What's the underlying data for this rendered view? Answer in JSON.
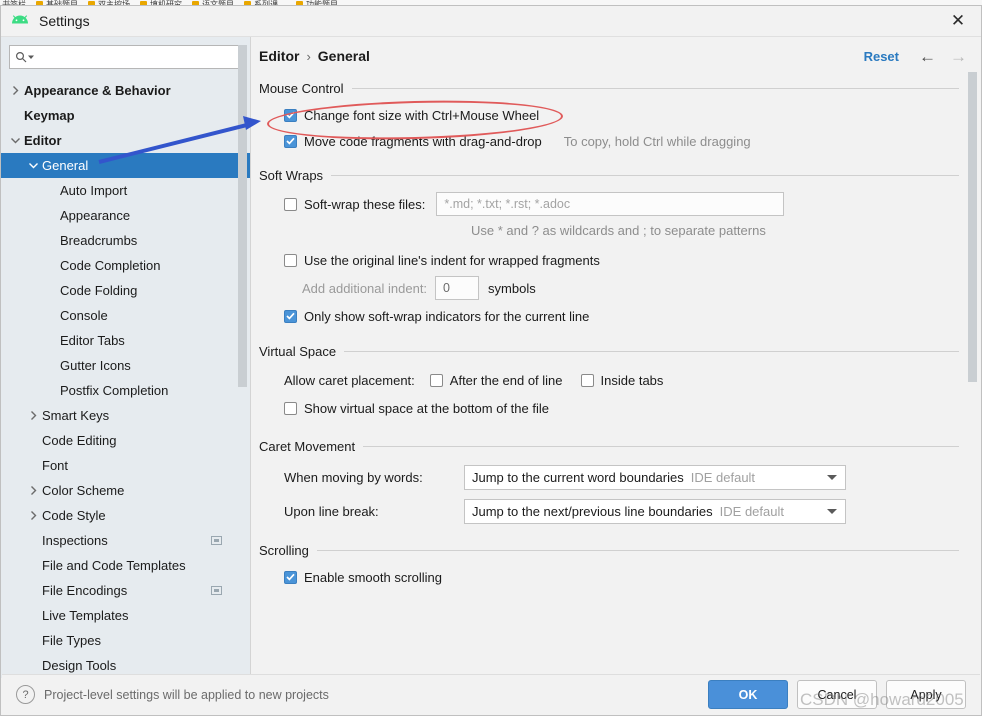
{
  "bookmarks": [
    {
      "label": "书签栏"
    },
    {
      "label": "基础题目"
    },
    {
      "label": "双主控场"
    },
    {
      "label": "填机研究"
    },
    {
      "label": "语文题目"
    },
    {
      "label": "系列课、"
    },
    {
      "label": "功能题目"
    }
  ],
  "window": {
    "title": "Settings",
    "icon": "android-icon",
    "close_label": "✕"
  },
  "sidebar": {
    "search": {
      "value": "",
      "placeholder": "",
      "icon": "search-icon"
    },
    "items": [
      {
        "label": "Appearance & Behavior",
        "indent": 0,
        "chevron": "right",
        "bold": true,
        "selected": false,
        "project_icon": false
      },
      {
        "label": "Keymap",
        "indent": 0,
        "chevron": "none",
        "bold": true,
        "selected": false,
        "project_icon": false
      },
      {
        "label": "Editor",
        "indent": 0,
        "chevron": "down",
        "bold": true,
        "selected": false,
        "project_icon": false
      },
      {
        "label": "General",
        "indent": 1,
        "chevron": "down",
        "bold": false,
        "selected": true,
        "project_icon": false
      },
      {
        "label": "Auto Import",
        "indent": 2,
        "chevron": "none",
        "bold": false,
        "selected": false,
        "project_icon": false
      },
      {
        "label": "Appearance",
        "indent": 2,
        "chevron": "none",
        "bold": false,
        "selected": false,
        "project_icon": false
      },
      {
        "label": "Breadcrumbs",
        "indent": 2,
        "chevron": "none",
        "bold": false,
        "selected": false,
        "project_icon": false
      },
      {
        "label": "Code Completion",
        "indent": 2,
        "chevron": "none",
        "bold": false,
        "selected": false,
        "project_icon": false
      },
      {
        "label": "Code Folding",
        "indent": 2,
        "chevron": "none",
        "bold": false,
        "selected": false,
        "project_icon": false
      },
      {
        "label": "Console",
        "indent": 2,
        "chevron": "none",
        "bold": false,
        "selected": false,
        "project_icon": false
      },
      {
        "label": "Editor Tabs",
        "indent": 2,
        "chevron": "none",
        "bold": false,
        "selected": false,
        "project_icon": false
      },
      {
        "label": "Gutter Icons",
        "indent": 2,
        "chevron": "none",
        "bold": false,
        "selected": false,
        "project_icon": false
      },
      {
        "label": "Postfix Completion",
        "indent": 2,
        "chevron": "none",
        "bold": false,
        "selected": false,
        "project_icon": false
      },
      {
        "label": "Smart Keys",
        "indent": 1,
        "chevron": "right",
        "bold": false,
        "selected": false,
        "project_icon": false
      },
      {
        "label": "Code Editing",
        "indent": 1,
        "chevron": "none",
        "bold": false,
        "selected": false,
        "project_icon": false
      },
      {
        "label": "Font",
        "indent": 1,
        "chevron": "none",
        "bold": false,
        "selected": false,
        "project_icon": false
      },
      {
        "label": "Color Scheme",
        "indent": 1,
        "chevron": "right",
        "bold": false,
        "selected": false,
        "project_icon": false
      },
      {
        "label": "Code Style",
        "indent": 1,
        "chevron": "right",
        "bold": false,
        "selected": false,
        "project_icon": false
      },
      {
        "label": "Inspections",
        "indent": 1,
        "chevron": "none",
        "bold": false,
        "selected": false,
        "project_icon": true
      },
      {
        "label": "File and Code Templates",
        "indent": 1,
        "chevron": "none",
        "bold": false,
        "selected": false,
        "project_icon": false
      },
      {
        "label": "File Encodings",
        "indent": 1,
        "chevron": "none",
        "bold": false,
        "selected": false,
        "project_icon": true
      },
      {
        "label": "Live Templates",
        "indent": 1,
        "chevron": "none",
        "bold": false,
        "selected": false,
        "project_icon": false
      },
      {
        "label": "File Types",
        "indent": 1,
        "chevron": "none",
        "bold": false,
        "selected": false,
        "project_icon": false
      },
      {
        "label": "Design Tools",
        "indent": 1,
        "chevron": "none",
        "bold": false,
        "selected": false,
        "project_icon": false
      }
    ]
  },
  "header": {
    "crumb1": "Editor",
    "separator": "›",
    "crumb2": "General",
    "reset_label": "Reset",
    "back_icon": "←",
    "forward_icon": "→"
  },
  "sections": {
    "mouse_control": {
      "title": "Mouse Control",
      "change_font_size": {
        "label": "Change font size with Ctrl+Mouse Wheel",
        "checked": true
      },
      "move_fragments": {
        "label": "Move code fragments with drag-and-drop",
        "checked": true
      },
      "move_fragments_hint": "To copy, hold Ctrl while dragging"
    },
    "soft_wraps": {
      "title": "Soft Wraps",
      "soft_wrap_files": {
        "label": "Soft-wrap these files:",
        "checked": false
      },
      "soft_wrap_value": "*.md; *.txt; *.rst; *.adoc",
      "wildcard_hint": "Use * and ? as wildcards and ; to separate patterns",
      "original_indent": {
        "label": "Use the original line's indent for wrapped fragments",
        "checked": false
      },
      "add_indent_label": "Add additional indent:",
      "add_indent_value": "0",
      "symbols_label": "symbols",
      "only_show_indicators": {
        "label": "Only show soft-wrap indicators for the current line",
        "checked": true
      }
    },
    "virtual_space": {
      "title": "Virtual Space",
      "allow_caret_label": "Allow caret placement:",
      "after_end_of_line": {
        "label": "After the end of line",
        "checked": false
      },
      "inside_tabs": {
        "label": "Inside tabs",
        "checked": false
      },
      "show_virtual_space": {
        "label": "Show virtual space at the bottom of the file",
        "checked": false
      }
    },
    "caret_movement": {
      "title": "Caret Movement",
      "when_moving_label": "When moving by words:",
      "when_moving_value": "Jump to the current word boundaries",
      "when_moving_default": "IDE default",
      "upon_line_break_label": "Upon line break:",
      "upon_line_break_value": "Jump to the next/previous line boundaries",
      "upon_line_break_default": "IDE default"
    },
    "scrolling": {
      "title": "Scrolling",
      "smooth_scrolling": {
        "label": "Enable smooth scrolling",
        "checked": true
      }
    }
  },
  "footer": {
    "help_icon": "?",
    "note": "Project-level settings will be applied to new projects",
    "ok_label": "OK",
    "cancel_label": "Cancel",
    "apply_label": "Apply"
  },
  "annotations": {
    "watermark": "CSDN @howard2005",
    "ellipse_color": "#e05a5a",
    "arrow_color": "#3355cc"
  },
  "colors": {
    "accent_blue": "#2a7ac0",
    "primary_button": "#4a90d9",
    "sidebar_bg": "#e6ebef",
    "panel_bg": "#f2f2f2"
  }
}
